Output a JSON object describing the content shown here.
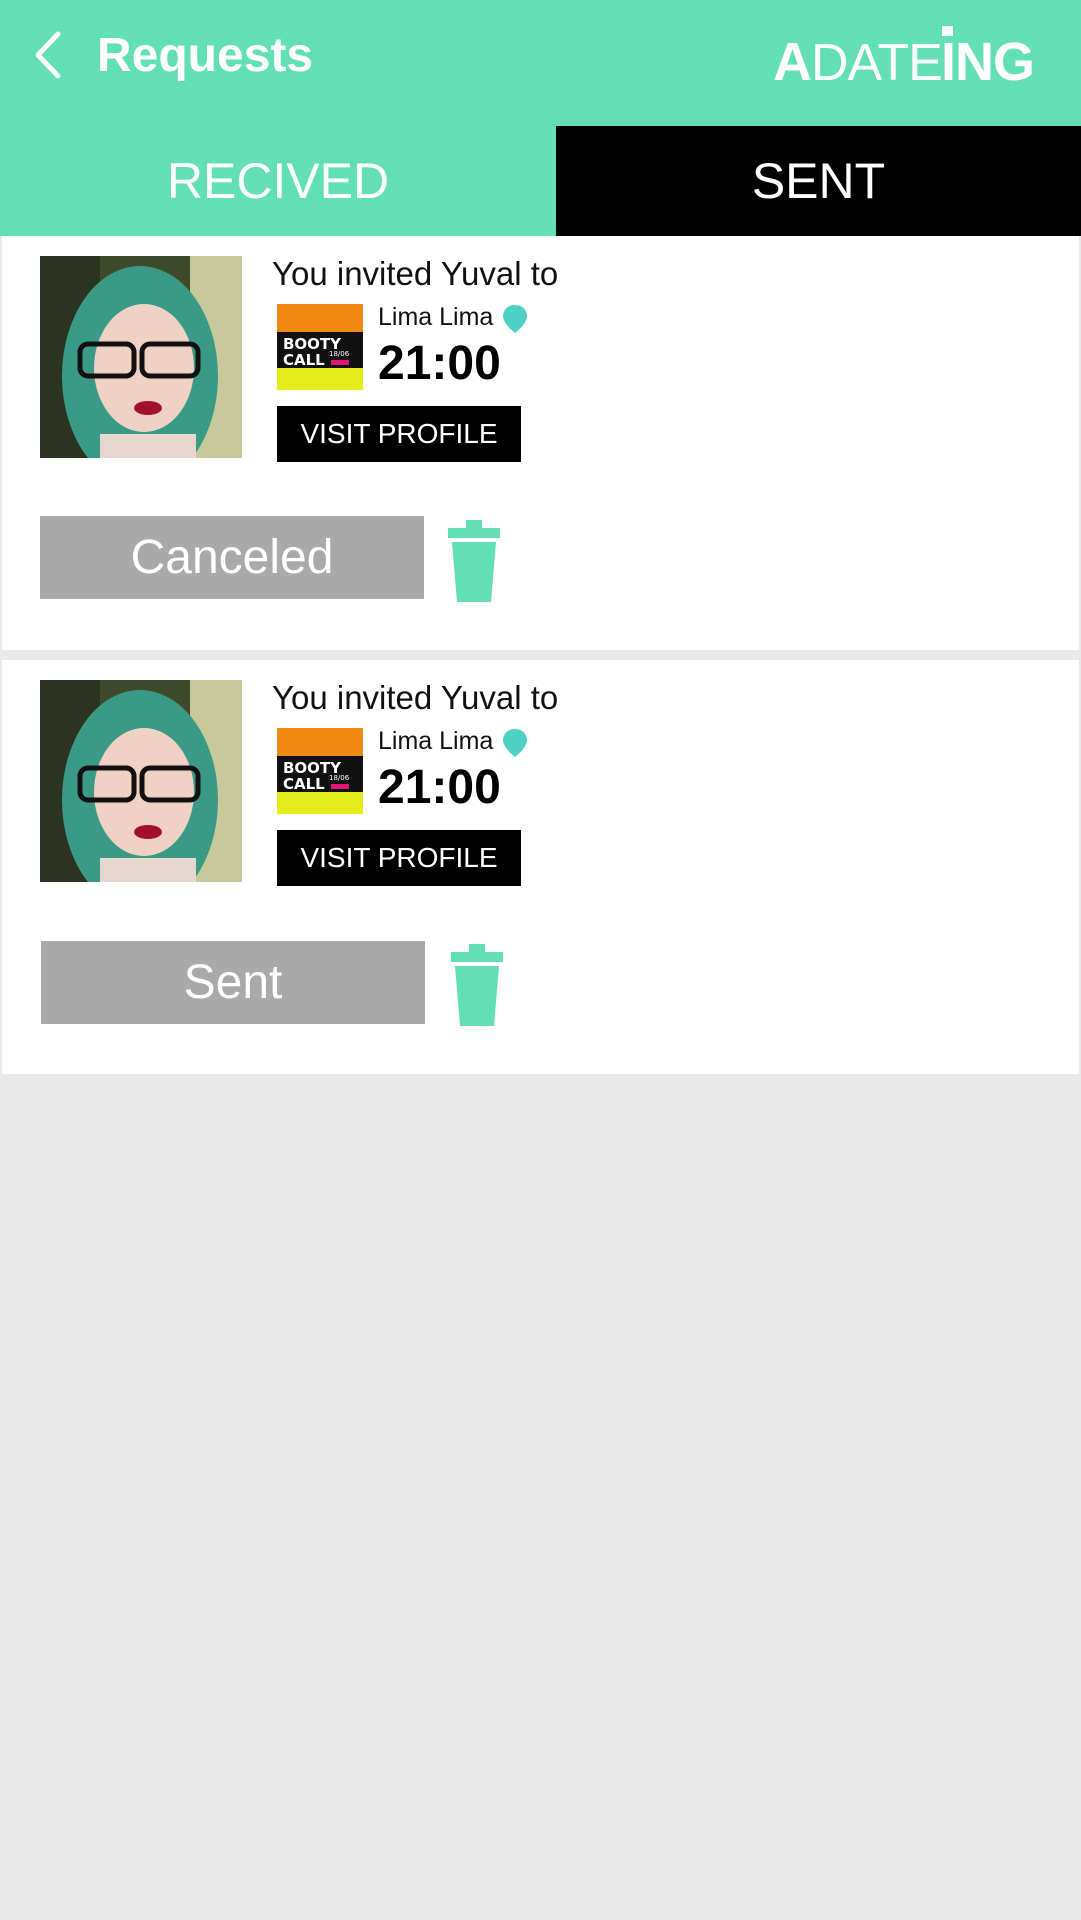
{
  "header": {
    "title": "Requests",
    "logo_text": "ADATEING",
    "back_icon": "chevron-left-icon",
    "color": "#63dfb6"
  },
  "tabs": [
    {
      "label": "RECIVED",
      "active": false
    },
    {
      "label": "SENT",
      "active": true
    }
  ],
  "requests": [
    {
      "invite_text": "You invited Yuval to",
      "venue": "Lima Lima",
      "time": "21:00",
      "visit_label": "VISIT PROFILE",
      "status": "Canceled",
      "event_badge": "BOOTY CALL",
      "event_date": "18/06"
    },
    {
      "invite_text": "You invited Yuval to",
      "venue": "Lima Lima",
      "time": "21:00",
      "visit_label": "VISIT PROFILE",
      "status": "Sent",
      "event_badge": "BOOTY CALL",
      "event_date": "18/06"
    }
  ],
  "colors": {
    "accent": "#63dfb6",
    "status_gray": "#a9a9a9",
    "pin": "#4fd0c4"
  }
}
